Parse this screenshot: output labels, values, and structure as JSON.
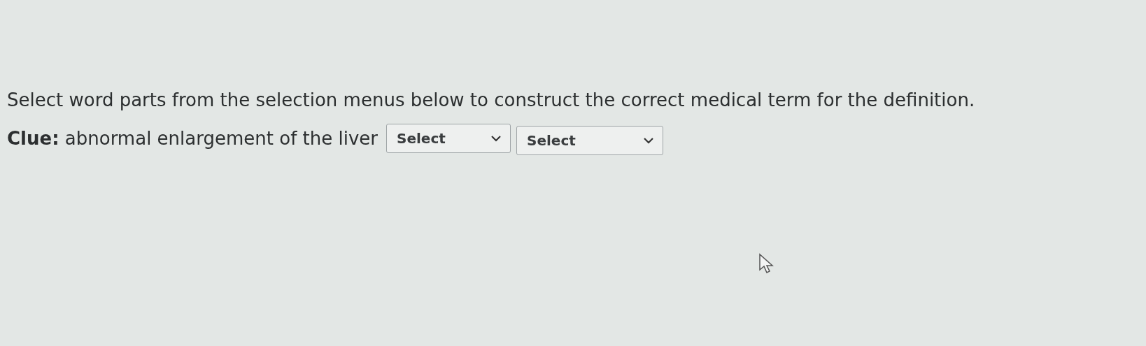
{
  "instruction": "Select word parts from the selection menus below to construct the correct medical term for the definition.",
  "clue": {
    "label": "Clue:",
    "text": "abnormal enlargement of the liver"
  },
  "selects": [
    {
      "value": "Select"
    },
    {
      "value": "Select"
    }
  ]
}
